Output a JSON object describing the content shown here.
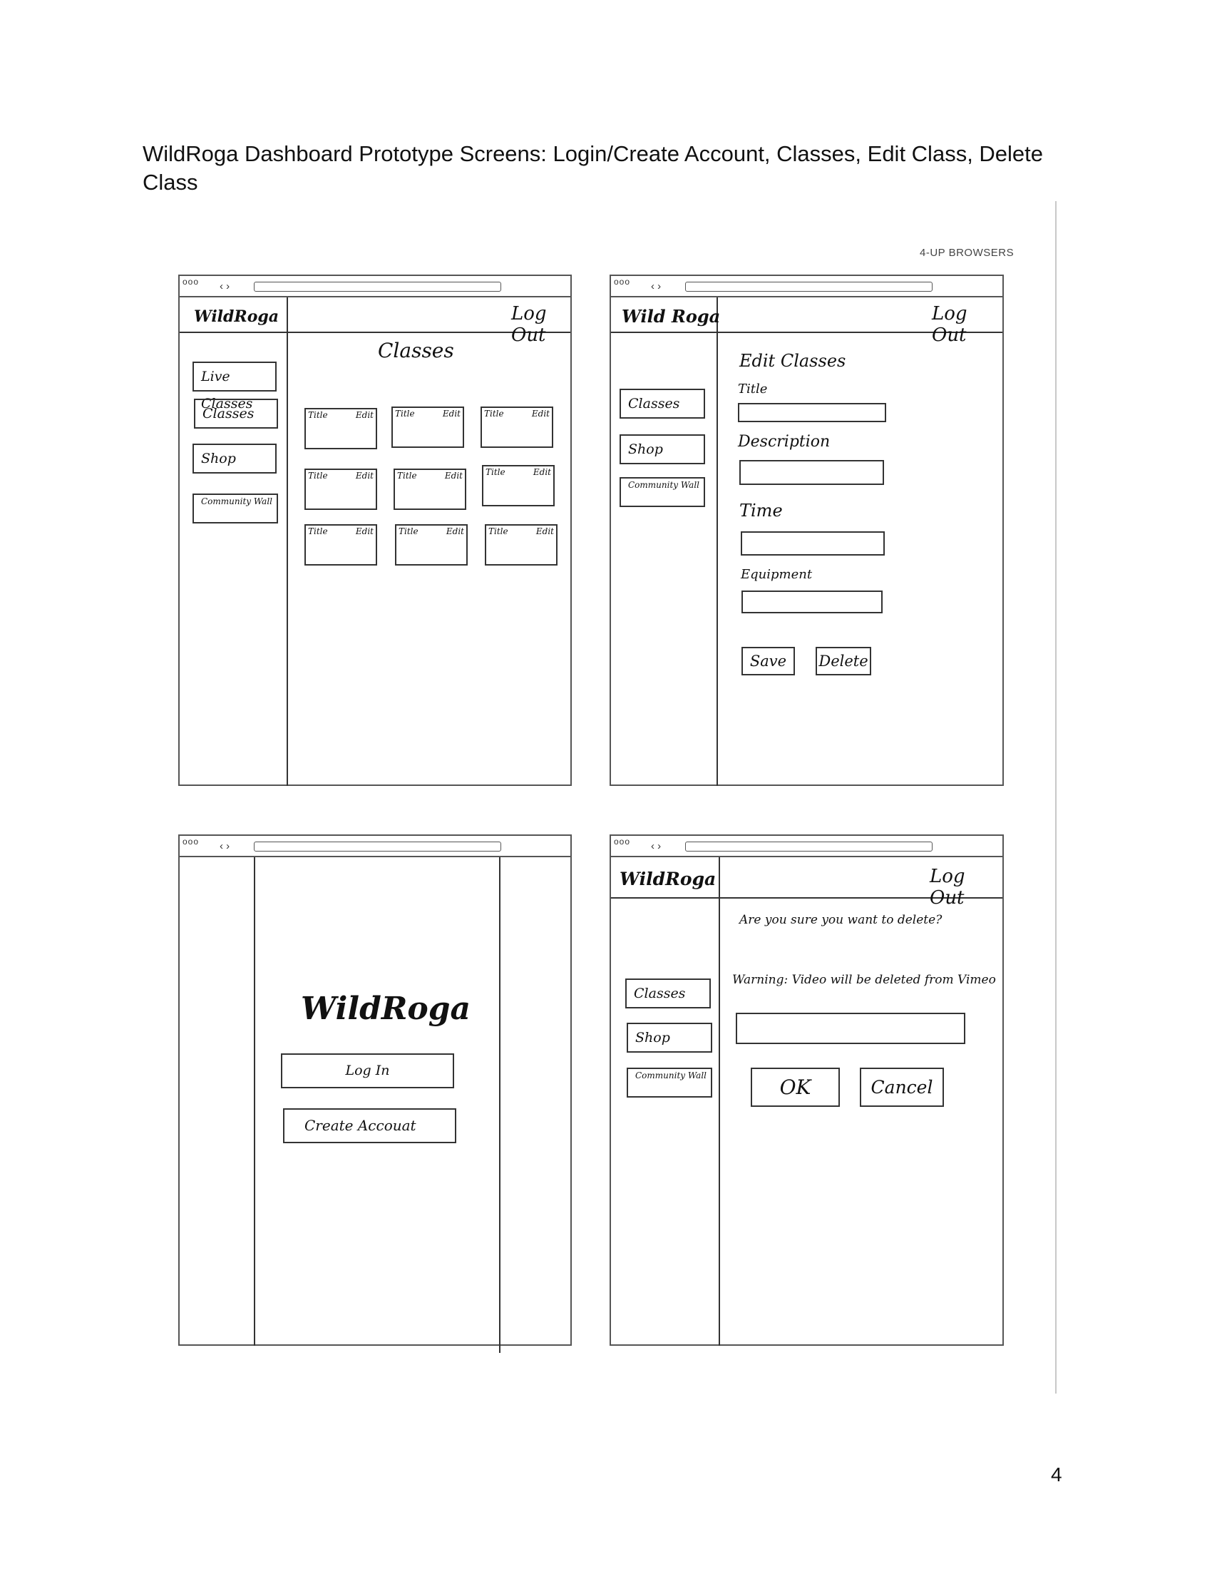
{
  "document": {
    "heading": "WildRoga Dashboard Prototype Screens: Login/Create Account, Classes, Edit Class, Delete Class",
    "corner_label": "4-UP BROWSERS",
    "page_number": "4"
  },
  "browser": {
    "dots": "ooo",
    "nav_arrows": "‹ ›"
  },
  "classes_screen": {
    "logo": "WildRoga",
    "logout": "Log Out",
    "title": "Classes",
    "nav": [
      "Live Classes",
      "Classes",
      "Shop",
      "Community Wall"
    ],
    "cards": [
      {
        "title": "Title",
        "edit": "Edit"
      },
      {
        "title": "Title",
        "edit": "Edit"
      },
      {
        "title": "Title",
        "edit": "Edit"
      },
      {
        "title": "Title",
        "edit": "Edit"
      },
      {
        "title": "Title",
        "edit": "Edit"
      },
      {
        "title": "Title",
        "edit": "Edit"
      },
      {
        "title": "Title",
        "edit": "Edit"
      },
      {
        "title": "Title",
        "edit": "Edit"
      },
      {
        "title": "Title",
        "edit": "Edit"
      }
    ]
  },
  "edit_screen": {
    "logo": "Wild Roga",
    "logout": "Log Out",
    "title": "Edit Classes",
    "nav": [
      "Classes",
      "Shop",
      "Community Wall"
    ],
    "fields": [
      "Title",
      "Description",
      "Time",
      "Equipment"
    ],
    "save": "Save",
    "delete": "Delete"
  },
  "login_screen": {
    "logo": "WildRoga",
    "login": "Log In",
    "create_account": "Create Accouat"
  },
  "delete_screen": {
    "logo": "WildRoga",
    "logout": "Log Out",
    "question": "Are you sure you want to delete?",
    "warning": "Warning: Video will be deleted from Vimeo",
    "nav": [
      "Classes",
      "Shop",
      "Community Wall"
    ],
    "ok": "OK",
    "cancel": "Cancel"
  }
}
